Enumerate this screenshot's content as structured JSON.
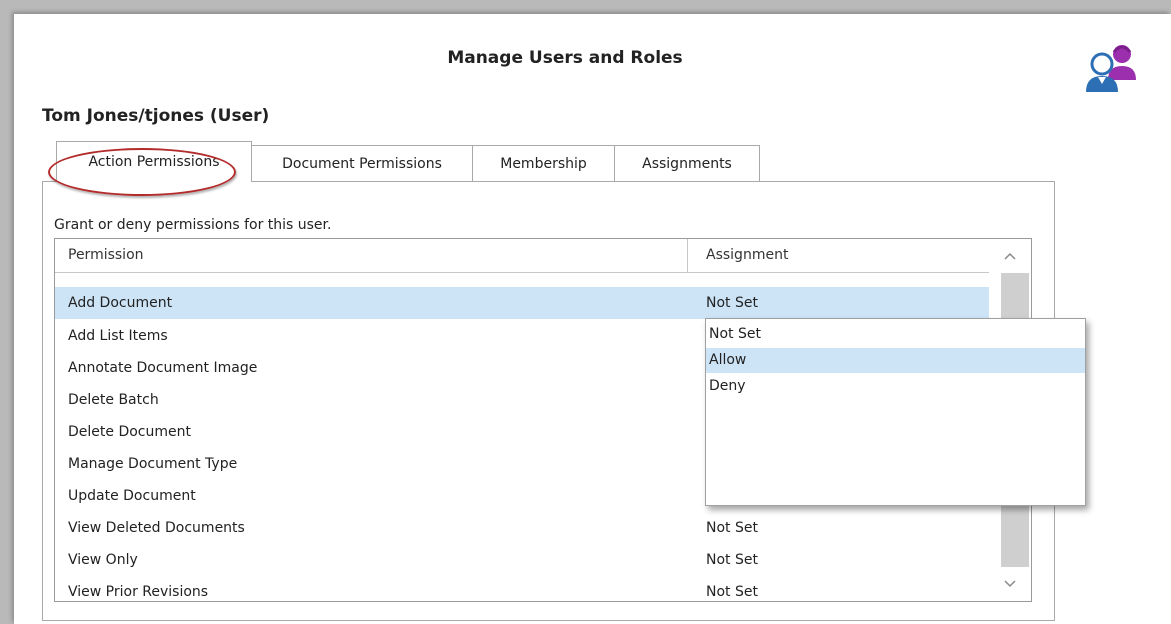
{
  "window": {
    "title": "Manage Users and Roles",
    "icon": "users-icon"
  },
  "user": {
    "heading": "Tom Jones/tjones (User)"
  },
  "tabs": [
    {
      "label": "Action Permissions",
      "active": true
    },
    {
      "label": "Document Permissions",
      "active": false
    },
    {
      "label": "Membership",
      "active": false
    },
    {
      "label": "Assignments",
      "active": false
    }
  ],
  "panel": {
    "hint": "Grant or deny permissions for this user."
  },
  "grid": {
    "columns": [
      "Permission",
      "Assignment"
    ],
    "rows": [
      {
        "permission": "Add Document",
        "assignment": "Not Set",
        "selected": true
      },
      {
        "permission": "Add List Items",
        "assignment": ""
      },
      {
        "permission": "Annotate Document Image",
        "assignment": ""
      },
      {
        "permission": "Delete Batch",
        "assignment": ""
      },
      {
        "permission": "Delete Document",
        "assignment": ""
      },
      {
        "permission": "Manage Document Type",
        "assignment": ""
      },
      {
        "permission": "Update Document",
        "assignment": ""
      },
      {
        "permission": "View Deleted Documents",
        "assignment": "Not Set"
      },
      {
        "permission": "View Only",
        "assignment": "Not Set"
      },
      {
        "permission": "View Prior Revisions",
        "assignment": "Not Set"
      }
    ]
  },
  "dropdown": {
    "options": [
      "Not Set",
      "Allow",
      "Deny"
    ],
    "highlighted": "Allow"
  },
  "colors": {
    "selection": "#cde4f7",
    "annotation_circle": "#b32b2b",
    "icon_blue": "#2d6fb4",
    "icon_purple": "#9b2fae"
  }
}
